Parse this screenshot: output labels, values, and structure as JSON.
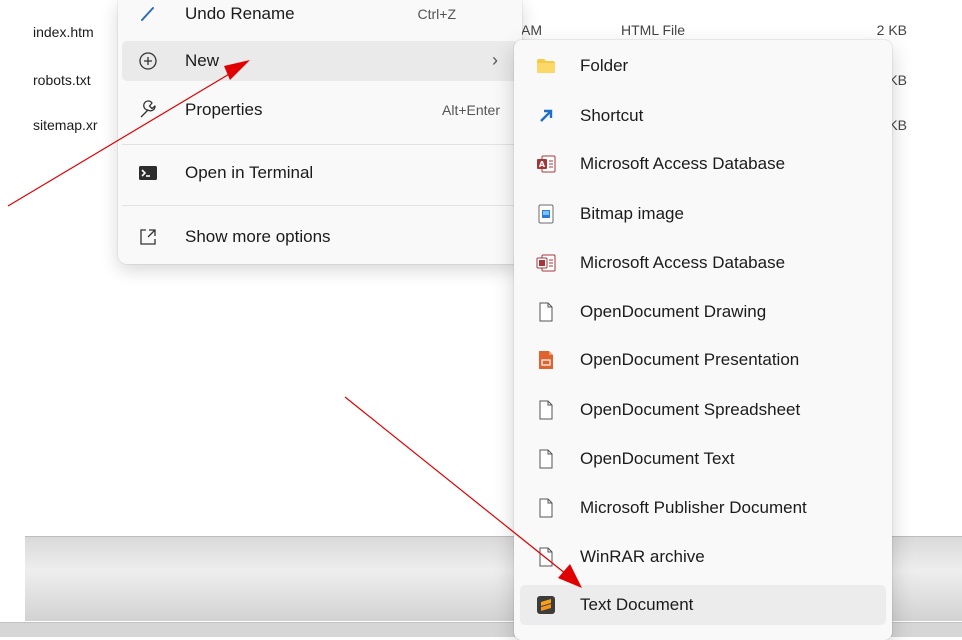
{
  "files": [
    {
      "name": "index.htm",
      "time": "AM",
      "type": "HTML File",
      "size": "2 KB"
    },
    {
      "name": "robots.txt",
      "size": "KB"
    },
    {
      "name": "sitemap.xr",
      "size": "KB"
    }
  ],
  "context_menu": {
    "undo": {
      "label": "Undo Rename",
      "accel": "Ctrl+Z",
      "icon": "undo-icon"
    },
    "new": {
      "label": "New",
      "chevron": "›",
      "icon": "plus-circle-icon"
    },
    "properties": {
      "label": "Properties",
      "accel": "Alt+Enter",
      "icon": "wrench-icon"
    },
    "terminal": {
      "label": "Open in Terminal",
      "icon": "terminal-icon"
    },
    "more": {
      "label": "Show more options",
      "icon": "expand-icon"
    }
  },
  "submenu": {
    "items": [
      {
        "label": "Folder",
        "icon": "folder-icon"
      },
      {
        "label": "Shortcut",
        "icon": "shortcut-icon"
      },
      {
        "label": "Microsoft Access Database",
        "icon": "access-icon"
      },
      {
        "label": "Bitmap image",
        "icon": "bitmap-icon"
      },
      {
        "label": "Microsoft Access Database",
        "icon": "access-icon"
      },
      {
        "label": "OpenDocument Drawing",
        "icon": "document-icon"
      },
      {
        "label": "OpenDocument Presentation",
        "icon": "presentation-icon"
      },
      {
        "label": "OpenDocument Spreadsheet",
        "icon": "document-icon"
      },
      {
        "label": "OpenDocument Text",
        "icon": "document-icon"
      },
      {
        "label": "Microsoft Publisher Document",
        "icon": "document-icon"
      },
      {
        "label": "WinRAR archive",
        "icon": "document-icon"
      },
      {
        "label": "Text Document",
        "icon": "sublime-text-icon"
      }
    ]
  },
  "colors": {
    "annotation_arrow": "#e00000",
    "folder": "#f7c948",
    "shortcut": "#1e6fc9",
    "access": "#a4373a",
    "presentation": "#e0622e"
  }
}
